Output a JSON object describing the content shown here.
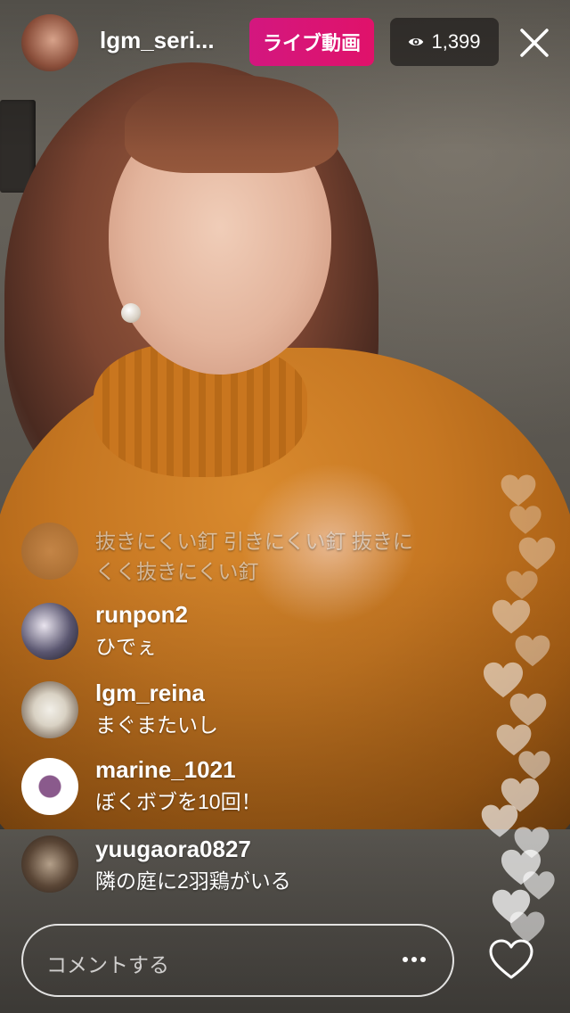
{
  "header": {
    "username": "lgm_seri...",
    "live_label": "ライブ動画",
    "viewer_count": "1,399",
    "eye_icon": "eye-icon",
    "close_icon": "close-icon"
  },
  "comments": [
    {
      "user": "",
      "lines": [
        "抜きにくい釘 引きにくい釘 抜きに",
        "くく抜きにくい釘"
      ],
      "faded": true
    },
    {
      "user": "runpon2",
      "lines": [
        "ひでぇ"
      ]
    },
    {
      "user": "lgm_reina",
      "lines": [
        "まぐまたいし"
      ]
    },
    {
      "user": "marine_1021",
      "lines": [
        "ぼくボブを10回！"
      ]
    },
    {
      "user": "yuugaora0827",
      "lines": [
        "隣の庭に2羽鶏がいる"
      ]
    }
  ],
  "bottom": {
    "comment_placeholder": "コメントする",
    "more_icon": "more-icon",
    "heart_icon": "heart-icon"
  },
  "colors": {
    "live_badge": "#d3177f",
    "viewer_badge_bg": "#1e1c1a",
    "text": "#ffffff"
  }
}
